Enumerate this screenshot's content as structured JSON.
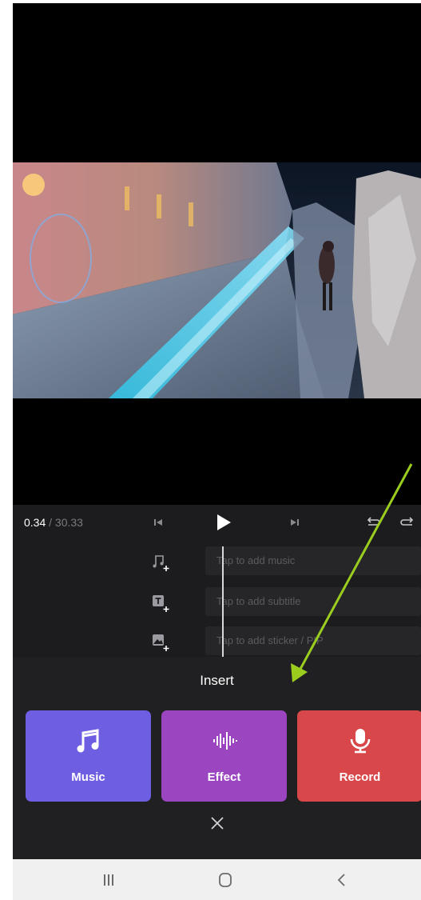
{
  "editor": {
    "time_current": "0.34",
    "time_separator": " / ",
    "time_total": "30.33",
    "tracks": [
      {
        "icon": "music-add-icon",
        "placeholder": "Tap to add music"
      },
      {
        "icon": "subtitle-add-icon",
        "placeholder": "Tap to add subtitle"
      },
      {
        "icon": "sticker-add-icon",
        "placeholder": "Tap to add sticker / PIP"
      }
    ]
  },
  "insert_panel": {
    "title": "Insert",
    "options": [
      {
        "label": "Music",
        "icon": "music-note-icon",
        "color": "#6e5ee2"
      },
      {
        "label": "Effect",
        "icon": "audio-wave-icon",
        "color": "#9b45c0"
      },
      {
        "label": "Record",
        "icon": "microphone-icon",
        "color": "#d8484a"
      }
    ]
  },
  "colors": {
    "annotation_arrow": "#9acd1e",
    "editor_background": "#1c1c1e",
    "panel_background": "#202022"
  }
}
